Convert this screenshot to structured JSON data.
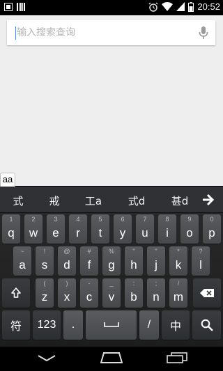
{
  "status_bar": {
    "time": "20:52",
    "left_icons": [
      "notification-icon",
      "barcode-icon"
    ],
    "right_icons": [
      "alarm-icon",
      "wifi-icon",
      "signal-icon",
      "battery-icon"
    ]
  },
  "search": {
    "placeholder": "输入搜索查询",
    "value": "",
    "mic_icon": "microphone-icon"
  },
  "composing_text": "aa",
  "keyboard": {
    "candidates": [
      "式",
      "戒",
      "工a",
      "式d",
      "甚d"
    ],
    "candidate_arrow_icon": "arrow-right-icon",
    "row1": [
      {
        "hint": "1",
        "label": "q"
      },
      {
        "hint": "2",
        "label": "w"
      },
      {
        "hint": "3",
        "label": "e"
      },
      {
        "hint": "4",
        "label": "r"
      },
      {
        "hint": "5",
        "label": "t"
      },
      {
        "hint": "6",
        "label": "y"
      },
      {
        "hint": "7",
        "label": "u"
      },
      {
        "hint": "8",
        "label": "i"
      },
      {
        "hint": "9",
        "label": "o"
      },
      {
        "hint": "0",
        "label": "p"
      }
    ],
    "row2": [
      {
        "hint": "~",
        "label": "a"
      },
      {
        "hint": "!",
        "label": "s"
      },
      {
        "hint": "@",
        "label": "d"
      },
      {
        "hint": "#",
        "label": "f"
      },
      {
        "hint": "%",
        "label": "g"
      },
      {
        "hint": "\"",
        "label": "h"
      },
      {
        "hint": "\"",
        "label": "j"
      },
      {
        "hint": "*",
        "label": "k"
      },
      {
        "hint": "?",
        "label": "l"
      }
    ],
    "row3": [
      {
        "hint": "(",
        "label": "z"
      },
      {
        "hint": ")",
        "label": "x"
      },
      {
        "hint": "-",
        "label": "c"
      },
      {
        "hint": "_",
        "label": "v"
      },
      {
        "hint": ":",
        "label": "b"
      },
      {
        "hint": ";",
        "label": "n"
      },
      {
        "hint": "/",
        "label": "m"
      }
    ],
    "shift_icon": "shift-arrow-icon",
    "delete_icon": "backspace-icon",
    "row4": {
      "symbol_label": "符",
      "number_label": "123",
      "period_label": ".",
      "space_icon": "space-bar-icon",
      "slash_label": "/",
      "lang_label": "中",
      "search_icon": "search-icon"
    }
  },
  "nav_bar": {
    "icons": [
      "back-icon",
      "home-icon",
      "recent-apps-icon"
    ]
  }
}
